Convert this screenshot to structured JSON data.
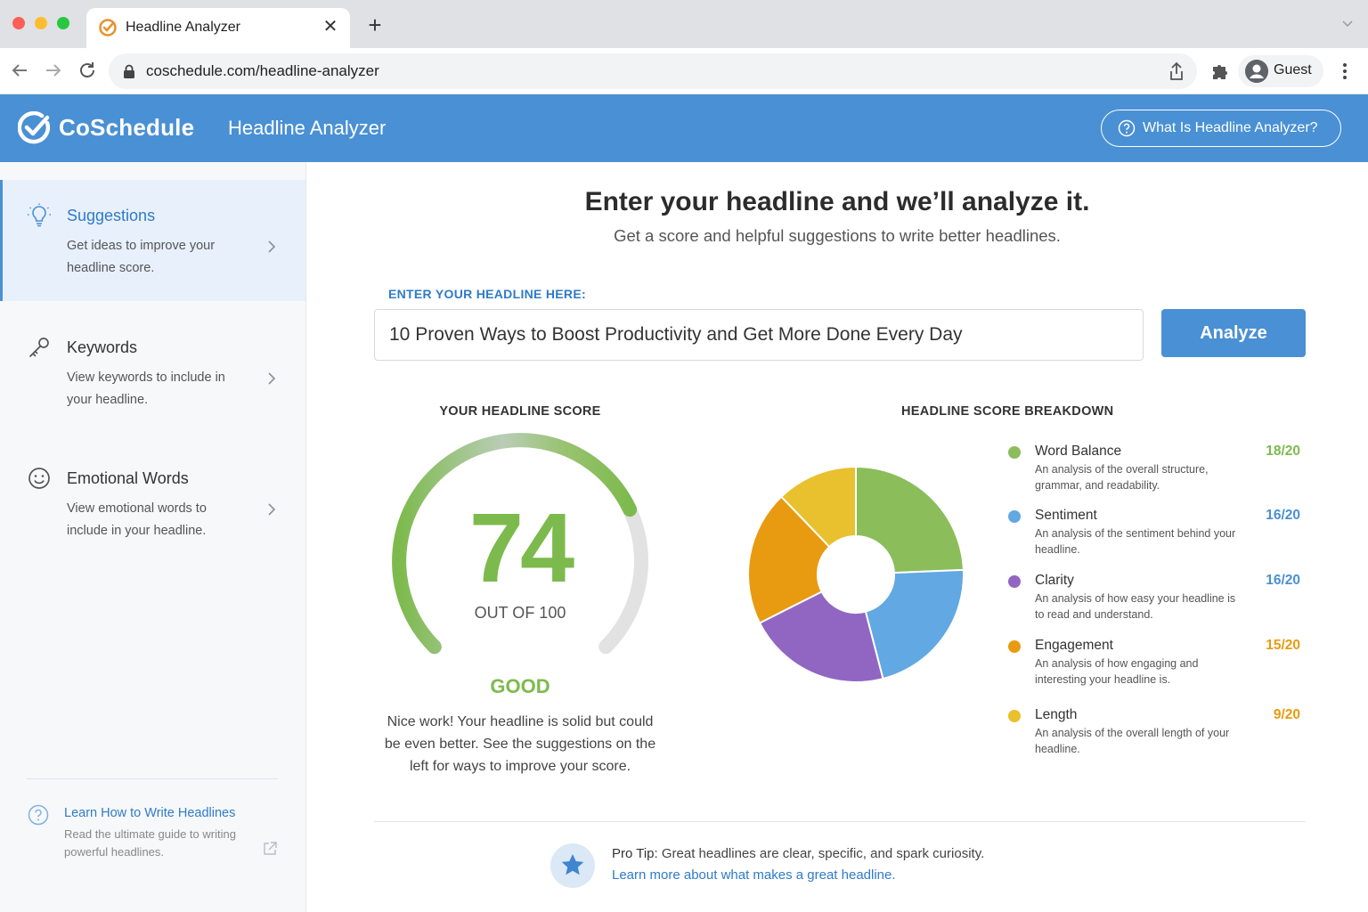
{
  "browser": {
    "tab_title": "Headline Analyzer",
    "url": "coschedule.com/headline-analyzer",
    "profile_label": "Guest",
    "icons": [
      "back-arrow-icon",
      "forward-arrow-icon",
      "reload-icon",
      "lock-icon",
      "share-icon",
      "extensions-icon",
      "avatar-icon",
      "kebab-menu-icon"
    ]
  },
  "header": {
    "logo": "CoSchedule",
    "title": "Headline Analyzer",
    "help_button": "What Is Headline Analyzer?",
    "bg_color": "#4a90d4"
  },
  "sidebar": {
    "items": [
      {
        "title": "Suggestions",
        "desc": "Get ideas to improve your headline score.",
        "icon": "lightbulb-icon",
        "active": true
      },
      {
        "title": "Keywords",
        "desc": "View keywords to include in your headline.",
        "icon": "key-icon",
        "active": false
      },
      {
        "title": "Emotional Words",
        "desc": "View emotional words to include in your headline.",
        "icon": "smiley-icon",
        "active": false
      }
    ],
    "learn": {
      "title": "Learn How to Write Headlines",
      "desc": "Read the ultimate guide to writing powerful headlines."
    }
  },
  "main": {
    "title": "Enter your headline and we’ll analyze it.",
    "subtitle": "Get a score and helpful suggestions to write better headlines.",
    "input_label": "ENTER YOUR HEADLINE HERE:",
    "headline_value": "10 Proven Ways to Boost Productivity and Get More Done Every Day",
    "analyze_label": "Analyze"
  },
  "score": {
    "label": "YOUR HEADLINE SCORE",
    "value": "74",
    "value_num": 74,
    "max": 100,
    "out_of": "OUT OF 100",
    "rating": "GOOD",
    "message": "Nice work! Your headline is solid but could be even better. See the suggestions on the left for ways to improve your score.",
    "color": "#7dba4d"
  },
  "breakdown": {
    "label": "HEADLINE SCORE BREAKDOWN",
    "items": [
      {
        "name": "Word Balance",
        "desc": "An analysis of the overall structure, grammar, and readability.",
        "score": "18/20",
        "value": 18,
        "color": "#8bbd5b",
        "score_color": "#7dba4d"
      },
      {
        "name": "Sentiment",
        "desc": "An analysis of the sentiment behind your headline.",
        "score": "16/20",
        "value": 16,
        "color": "#62a8e2",
        "score_color": "#4a90d4"
      },
      {
        "name": "Clarity",
        "desc": "An analysis of how easy your headline is to read and understand.",
        "score": "16/20",
        "value": 16,
        "color": "#9166c2",
        "score_color": "#4a90d4"
      },
      {
        "name": "Engagement",
        "desc": "An analysis of how engaging and interesting your headline is.",
        "score": "15/20",
        "value": 15,
        "color": "#e89b10",
        "score_color": "#e89b10"
      },
      {
        "name": "Length",
        "desc": "An analysis of the overall length of your headline.",
        "score": "9/20",
        "value": 9,
        "color": "#e9c02e",
        "score_color": "#e89b10"
      }
    ]
  },
  "tip": {
    "prefix": "Pro Tip:",
    "text": " Great headlines are clear, specific, and spark curiosity.",
    "link": "Learn more about what makes a great headline."
  }
}
